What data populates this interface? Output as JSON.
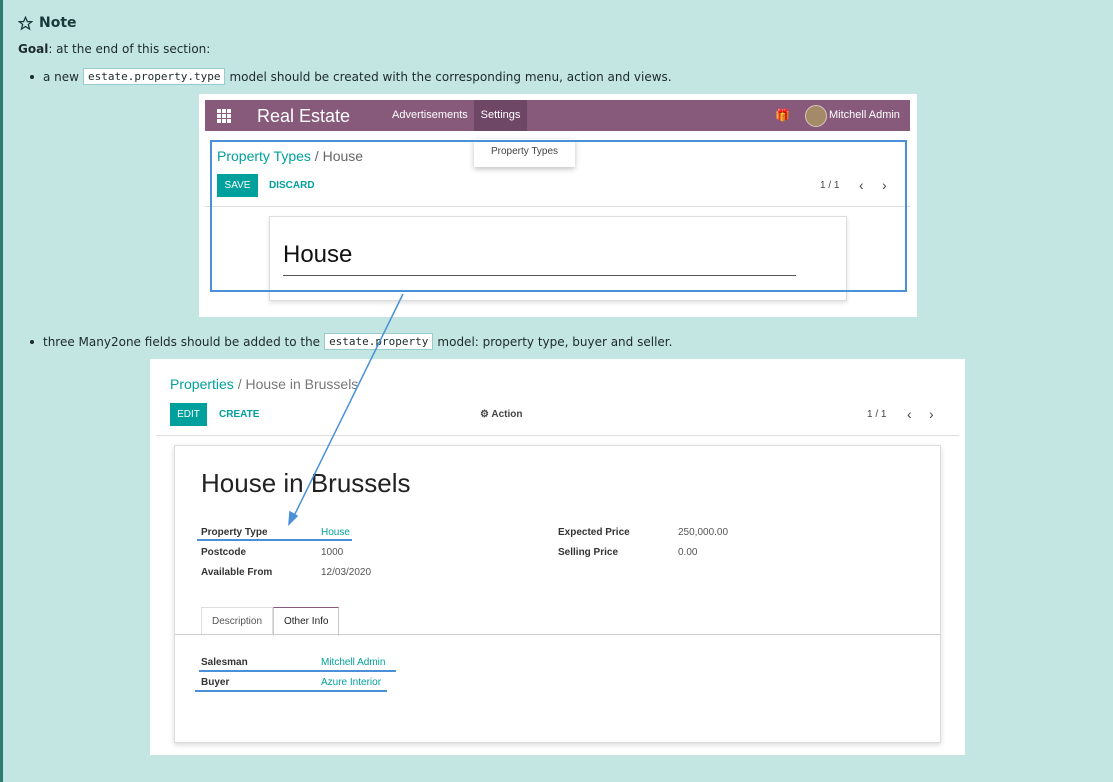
{
  "note": {
    "title": "Note",
    "goal_label": "Goal",
    "goal_text": ": at the end of this section:"
  },
  "bullets": [
    {
      "pre": "a new",
      "code": "estate.property.type",
      "post": "model should be created with the corresponding menu, action and views."
    },
    {
      "pre": "three Many2one fields should be added to the",
      "code": "estate.property",
      "post": "model: property type, buyer and seller."
    }
  ],
  "shot1": {
    "brand": "Real Estate",
    "menu_advertisements": "Advertisements",
    "menu_settings": "Settings",
    "user_name": "Mitchell Admin",
    "dropdown_item": "Property Types",
    "breadcrumb_parent": "Property Types",
    "breadcrumb_sep": "/",
    "breadcrumb_current": "House",
    "save_label": "SAVE",
    "discard_label": "DISCARD",
    "pager": "1 / 1",
    "record_name": "House"
  },
  "shot2": {
    "breadcrumb_parent": "Properties",
    "breadcrumb_sep": "/",
    "breadcrumb_current": "House in Brussels",
    "edit_label": "EDIT",
    "create_label": "CREATE",
    "action_label": "Action",
    "pager": "1 / 1",
    "record_title": "House in Brussels",
    "fields_left": [
      {
        "label": "Property Type",
        "value": "House"
      },
      {
        "label": "Postcode",
        "value": "1000"
      },
      {
        "label": "Available From",
        "value": "12/03/2020"
      }
    ],
    "fields_right": [
      {
        "label": "Expected Price",
        "value": "250,000.00"
      },
      {
        "label": "Selling Price",
        "value": "0.00"
      }
    ],
    "tabs": [
      "Description",
      "Other Info"
    ],
    "other_info": [
      {
        "label": "Salesman",
        "value": "Mitchell Admin"
      },
      {
        "label": "Buyer",
        "value": "Azure Interior"
      }
    ]
  },
  "colors": {
    "background": "#c3e6e3",
    "odoo_purple": "#875a7b",
    "odoo_teal": "#00a09d",
    "highlight_blue": "#4a90d9"
  }
}
